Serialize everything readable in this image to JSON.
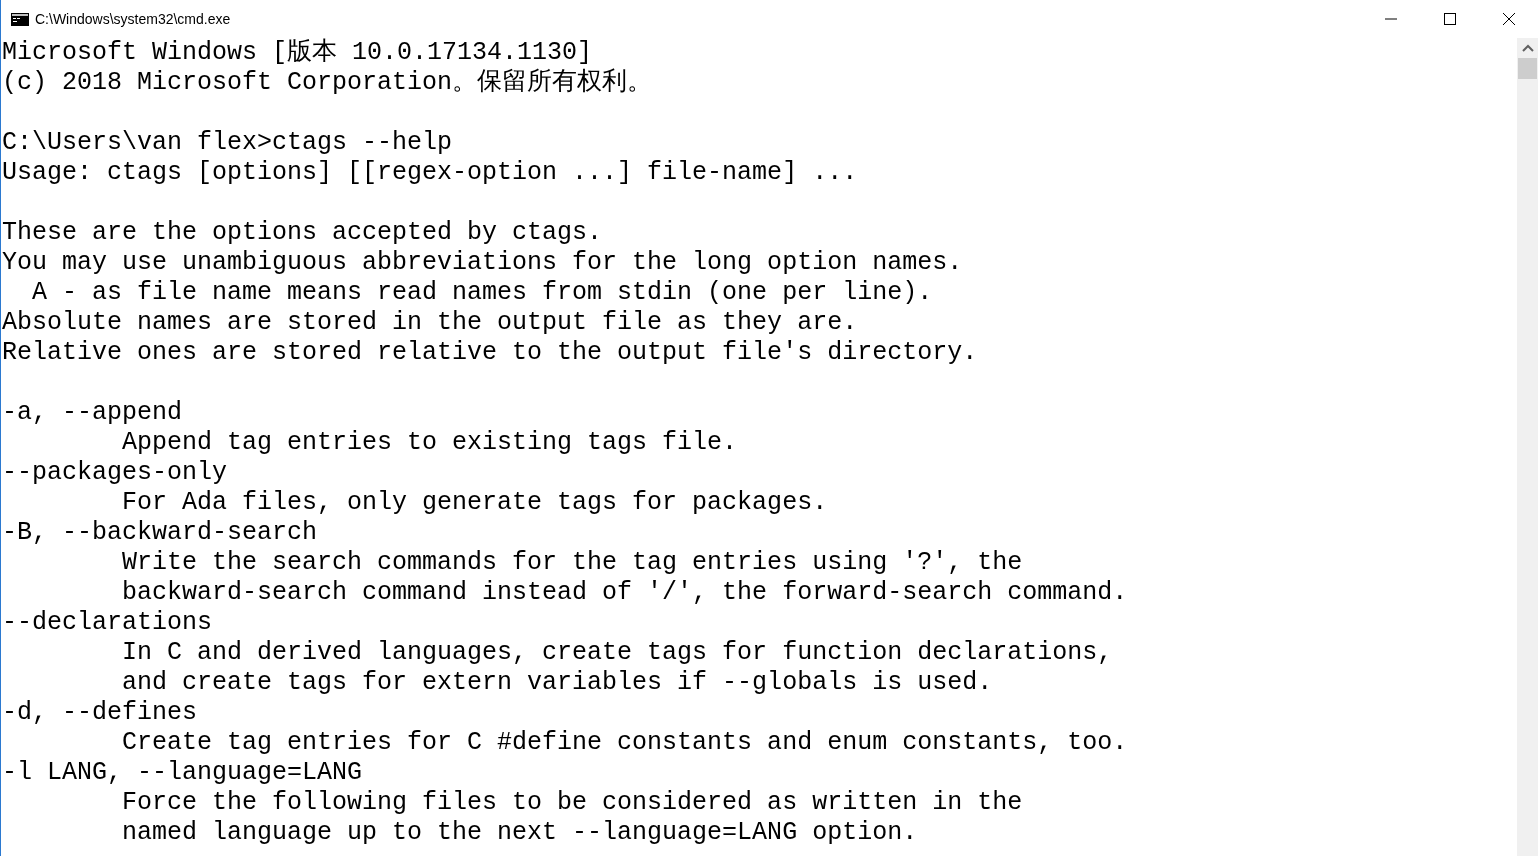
{
  "window": {
    "title": "C:\\Windows\\system32\\cmd.exe"
  },
  "console": {
    "paragraphs": [
      [
        "Microsoft Windows [版本 10.0.17134.1130]",
        "(c) 2018 Microsoft Corporation。保留所有权利。"
      ],
      [
        "C:\\Users\\van flex>ctags --help",
        "Usage: ctags [options] [[regex-option ...] file-name] ..."
      ],
      [
        "These are the options accepted by ctags.",
        "You may use unambiguous abbreviations for the long option names.",
        "  A - as file name means read names from stdin (one per line).",
        "Absolute names are stored in the output file as they are.",
        "Relative ones are stored relative to the output file's directory."
      ],
      [
        "-a, --append",
        "        Append tag entries to existing tags file.",
        "--packages-only",
        "        For Ada files, only generate tags for packages.",
        "-B, --backward-search",
        "        Write the search commands for the tag entries using '?', the",
        "        backward-search command instead of '/', the forward-search command.",
        "--declarations",
        "        In C and derived languages, create tags for function declarations,",
        "        and create tags for extern variables if --globals is used.",
        "-d, --defines",
        "        Create tag entries for C #define constants and enum constants, too.",
        "-l LANG, --language=LANG",
        "        Force the following files to be considered as written in the",
        "        named language up to the next --language=LANG option."
      ]
    ]
  }
}
